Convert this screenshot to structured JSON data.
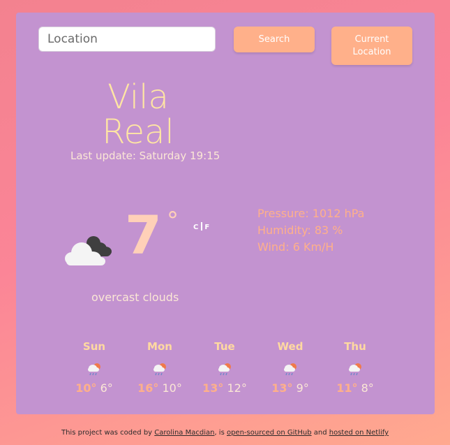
{
  "search": {
    "placeholder": "Location"
  },
  "buttons": {
    "search_label": "Search",
    "current_location_label": "Current Location"
  },
  "current": {
    "city": "Vila Real",
    "last_update": "Last update: Saturday 19:15",
    "temperature": "7",
    "degree_symbol": "°",
    "unit_c": "C",
    "unit_f": "F",
    "pressure": "Pressure: 1012 hPa",
    "humidity": "Humidity: 83 %",
    "wind": "Wind: 6 Km/H",
    "description": "overcast clouds",
    "icon": "overcast-clouds-icon"
  },
  "forecast": [
    {
      "day": "Sun",
      "max": "10°",
      "min": "6°",
      "icon": "rain-showers-icon"
    },
    {
      "day": "Mon",
      "max": "16°",
      "min": "10°",
      "icon": "rain-showers-icon"
    },
    {
      "day": "Tue",
      "max": "13°",
      "min": "12°",
      "icon": "rain-showers-icon"
    },
    {
      "day": "Wed",
      "max": "13°",
      "min": "9°",
      "icon": "rain-showers-icon"
    },
    {
      "day": "Thu",
      "max": "11°",
      "min": "8°",
      "icon": "rain-showers-icon"
    }
  ],
  "footer": {
    "prefix": "This project was coded by ",
    "author_link": "Carolina Macdian",
    "middle": ", is ",
    "github_link": "open-sourced on GitHub",
    "and": " and ",
    "netlify_link": "hosted on Netlify"
  },
  "colors": {
    "card": "#c393d0",
    "button": "#ffb08a",
    "city_text": "#ffe6a3",
    "temperature": "#ffd0b8",
    "details": "#ffb08a"
  }
}
